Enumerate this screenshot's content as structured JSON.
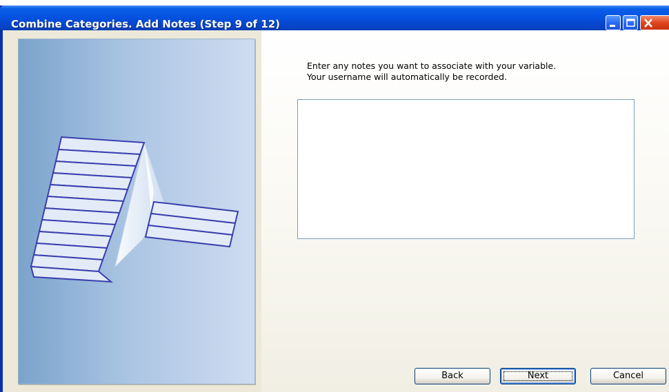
{
  "window": {
    "title": "Combine Categories.  Add Notes (Step 9 of 12)",
    "controls": {
      "minimize_icon": "minimize-icon",
      "maximize_icon": "maximize-icon",
      "close_icon": "close-icon"
    }
  },
  "wizard": {
    "instructions_line1": "Enter any notes you want to associate with your variable.",
    "instructions_line2": "Your username will automatically be recorded.",
    "notes_value": "",
    "illustration_icon": "combine-categories-illustration"
  },
  "buttons": {
    "back_label": "Back",
    "next_label": "Next",
    "cancel_label": "Cancel"
  },
  "colors": {
    "titlebar": "#0553e1",
    "dialog_background": "#ece9d8",
    "close_button": "#e0451f"
  }
}
